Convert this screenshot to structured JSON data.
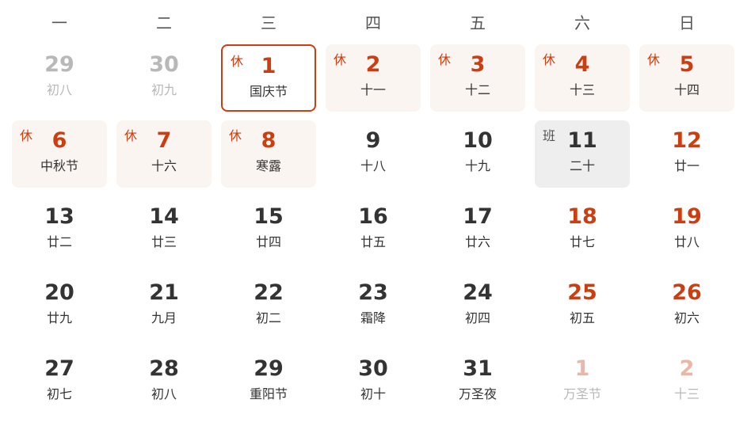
{
  "weekdays": [
    "一",
    "二",
    "三",
    "四",
    "五",
    "六",
    "日"
  ],
  "days": [
    {
      "day": "29",
      "lunar": "初八",
      "badge": "",
      "other": true,
      "red": false,
      "state": ""
    },
    {
      "day": "30",
      "lunar": "初九",
      "badge": "",
      "other": true,
      "red": false,
      "state": ""
    },
    {
      "day": "1",
      "lunar": "国庆节",
      "badge": "休",
      "other": false,
      "red": true,
      "state": "selected"
    },
    {
      "day": "2",
      "lunar": "十一",
      "badge": "休",
      "other": false,
      "red": true,
      "state": "holiday"
    },
    {
      "day": "3",
      "lunar": "十二",
      "badge": "休",
      "other": false,
      "red": true,
      "state": "holiday"
    },
    {
      "day": "4",
      "lunar": "十三",
      "badge": "休",
      "other": false,
      "red": true,
      "state": "holiday"
    },
    {
      "day": "5",
      "lunar": "十四",
      "badge": "休",
      "other": false,
      "red": true,
      "state": "holiday"
    },
    {
      "day": "6",
      "lunar": "中秋节",
      "badge": "休",
      "other": false,
      "red": true,
      "state": "holiday"
    },
    {
      "day": "7",
      "lunar": "十六",
      "badge": "休",
      "other": false,
      "red": true,
      "state": "holiday"
    },
    {
      "day": "8",
      "lunar": "寒露",
      "badge": "休",
      "other": false,
      "red": true,
      "state": "holiday"
    },
    {
      "day": "9",
      "lunar": "十八",
      "badge": "",
      "other": false,
      "red": false,
      "state": ""
    },
    {
      "day": "10",
      "lunar": "十九",
      "badge": "",
      "other": false,
      "red": false,
      "state": ""
    },
    {
      "day": "11",
      "lunar": "二十",
      "badge": "班",
      "other": false,
      "red": false,
      "state": "workday"
    },
    {
      "day": "12",
      "lunar": "廿一",
      "badge": "",
      "other": false,
      "red": true,
      "state": ""
    },
    {
      "day": "13",
      "lunar": "廿二",
      "badge": "",
      "other": false,
      "red": false,
      "state": ""
    },
    {
      "day": "14",
      "lunar": "廿三",
      "badge": "",
      "other": false,
      "red": false,
      "state": ""
    },
    {
      "day": "15",
      "lunar": "廿四",
      "badge": "",
      "other": false,
      "red": false,
      "state": ""
    },
    {
      "day": "16",
      "lunar": "廿五",
      "badge": "",
      "other": false,
      "red": false,
      "state": ""
    },
    {
      "day": "17",
      "lunar": "廿六",
      "badge": "",
      "other": false,
      "red": false,
      "state": ""
    },
    {
      "day": "18",
      "lunar": "廿七",
      "badge": "",
      "other": false,
      "red": true,
      "state": ""
    },
    {
      "day": "19",
      "lunar": "廿八",
      "badge": "",
      "other": false,
      "red": true,
      "state": ""
    },
    {
      "day": "20",
      "lunar": "廿九",
      "badge": "",
      "other": false,
      "red": false,
      "state": ""
    },
    {
      "day": "21",
      "lunar": "九月",
      "badge": "",
      "other": false,
      "red": false,
      "state": ""
    },
    {
      "day": "22",
      "lunar": "初二",
      "badge": "",
      "other": false,
      "red": false,
      "state": ""
    },
    {
      "day": "23",
      "lunar": "霜降",
      "badge": "",
      "other": false,
      "red": false,
      "state": ""
    },
    {
      "day": "24",
      "lunar": "初四",
      "badge": "",
      "other": false,
      "red": false,
      "state": ""
    },
    {
      "day": "25",
      "lunar": "初五",
      "badge": "",
      "other": false,
      "red": true,
      "state": ""
    },
    {
      "day": "26",
      "lunar": "初六",
      "badge": "",
      "other": false,
      "red": true,
      "state": ""
    },
    {
      "day": "27",
      "lunar": "初七",
      "badge": "",
      "other": false,
      "red": false,
      "state": ""
    },
    {
      "day": "28",
      "lunar": "初八",
      "badge": "",
      "other": false,
      "red": false,
      "state": ""
    },
    {
      "day": "29",
      "lunar": "重阳节",
      "badge": "",
      "other": false,
      "red": false,
      "state": ""
    },
    {
      "day": "30",
      "lunar": "初十",
      "badge": "",
      "other": false,
      "red": false,
      "state": ""
    },
    {
      "day": "31",
      "lunar": "万圣夜",
      "badge": "",
      "other": false,
      "red": false,
      "state": ""
    },
    {
      "day": "1",
      "lunar": "万圣节",
      "badge": "",
      "other": true,
      "red": true,
      "state": ""
    },
    {
      "day": "2",
      "lunar": "十三",
      "badge": "",
      "other": true,
      "red": true,
      "state": ""
    }
  ],
  "colors": {
    "accent": "#cc3d0f",
    "holiday_bg": "#fbf5f1",
    "workday_bg": "#eeeeee",
    "text": "#333333",
    "muted": "#b8b8b8"
  }
}
